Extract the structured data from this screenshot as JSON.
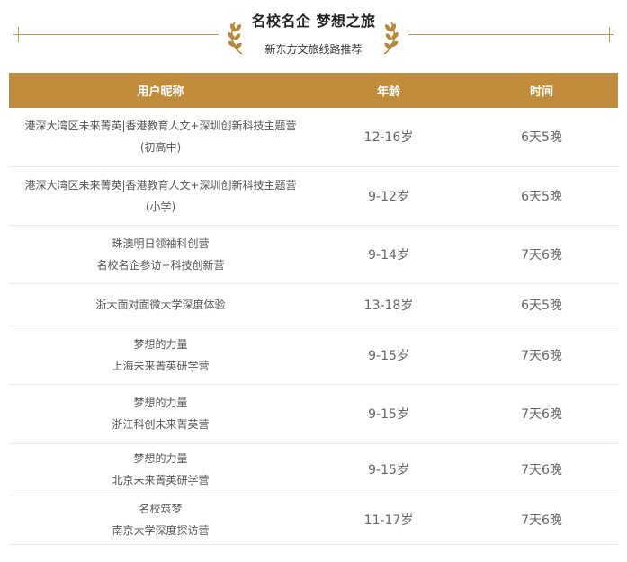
{
  "header": {
    "title": "名校名企 梦想之旅",
    "subtitle": "新东方文旅线路推荐"
  },
  "columns": [
    "用户昵称",
    "年龄",
    "时间"
  ],
  "rows": [
    {
      "name_line1": "港深大湾区未来菁英|香港教育人文+深圳创新科技主题营",
      "name_line2": "(初高中)",
      "age": "12-16岁",
      "duration": "6天5晚"
    },
    {
      "name_line1": "港深大湾区未来菁英|香港教育人文+深圳创新科技主题营",
      "name_line2": "(小学)",
      "age": "9-12岁",
      "duration": "6天5晚"
    },
    {
      "name_line1": "珠澳明日领袖科创营",
      "name_line2": "名校名企参访+科技创新营",
      "age": "9-14岁",
      "duration": "7天6晚"
    },
    {
      "name_line1": "浙大面对面微大学深度体验",
      "name_line2": "",
      "age": "13-18岁",
      "duration": "6天5晚"
    },
    {
      "name_line1": "梦想的力量",
      "name_line2": "上海未来菁英研学营",
      "age": "9-15岁",
      "duration": "7天6晚"
    },
    {
      "name_line1": "梦想的力量",
      "name_line2": "浙江科创未来菁英营",
      "age": "9-15岁",
      "duration": "7天6晚"
    },
    {
      "name_line1": "梦想的力量",
      "name_line2": "北京未来菁英研学营",
      "age": "9-15岁",
      "duration": "7天6晚"
    },
    {
      "name_line1": "名校筑梦",
      "name_line2": "南京大学深度探访营",
      "age": "11-17岁",
      "duration": "7天6晚"
    }
  ],
  "colors": {
    "accent": "#c08b3a",
    "laurel": "#b8893c"
  },
  "icons": [
    "laurel-left-icon",
    "laurel-right-icon"
  ]
}
